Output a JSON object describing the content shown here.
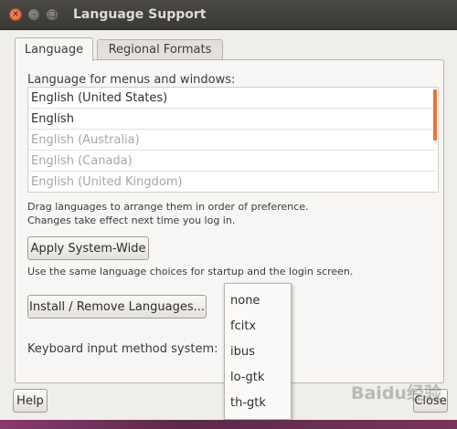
{
  "window": {
    "title": "Language Support"
  },
  "tabs": [
    {
      "label": "Language",
      "active": true
    },
    {
      "label": "Regional Formats",
      "active": false
    }
  ],
  "language_section": {
    "label": "Language for menus and windows:",
    "items": [
      {
        "label": "English (United States)",
        "enabled": true
      },
      {
        "label": "English",
        "enabled": true
      },
      {
        "label": "English (Australia)",
        "enabled": false
      },
      {
        "label": "English (Canada)",
        "enabled": false
      },
      {
        "label": "English (United Kingdom)",
        "enabled": false
      }
    ],
    "hint_line1": "Drag languages to arrange them in order of preference.",
    "hint_line2": "Changes take effect next time you log in."
  },
  "apply_button": "Apply System-Wide",
  "apply_description": "Use the same language choices for startup and the login screen.",
  "install_button": "Install / Remove Languages...",
  "keyboard_label": "Keyboard input method system:",
  "input_method_options": [
    "none",
    "fcitx",
    "ibus",
    "lo-gtk",
    "th-gtk"
  ],
  "footer": {
    "help": "Help",
    "close": "Close"
  },
  "watermark": "Baidu经验",
  "colors": {
    "accent": "#e9733a",
    "titlebar": "#3c3b37"
  }
}
